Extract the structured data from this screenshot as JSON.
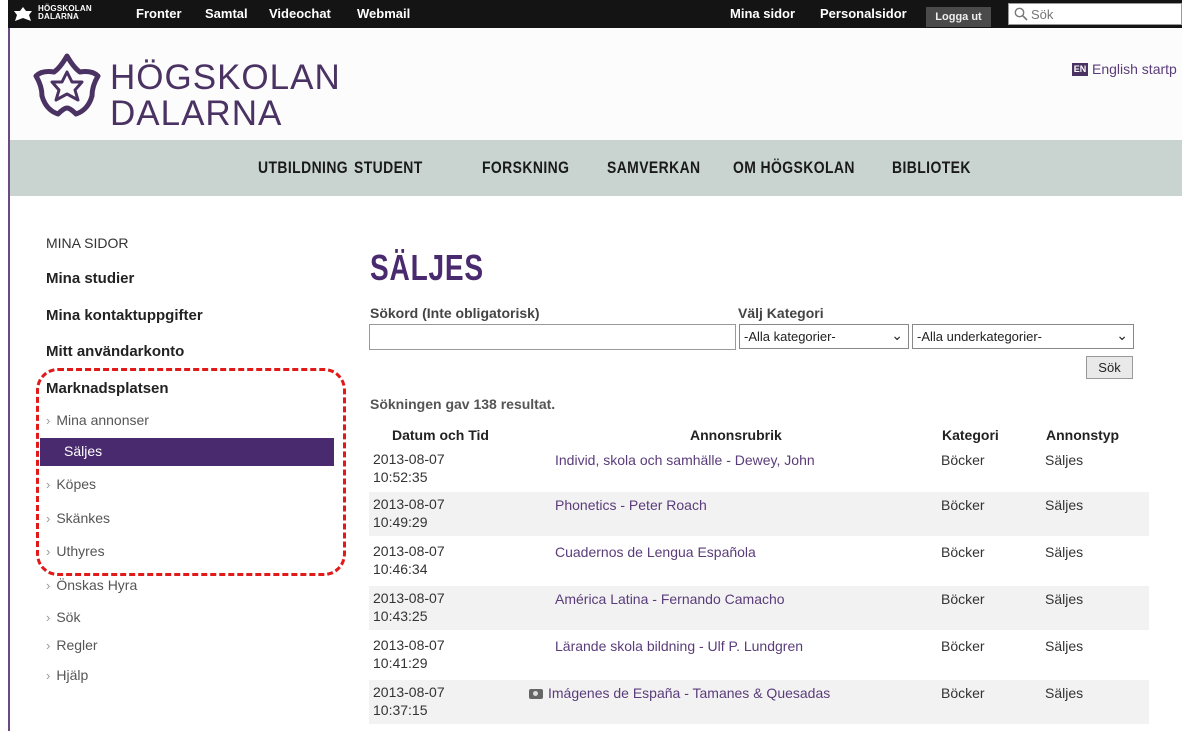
{
  "topbar": {
    "logo_line1": "HÖGSKOLAN",
    "logo_line2": "DALARNA",
    "links": [
      "Fronter",
      "Samtal",
      "Videochat",
      "Webmail"
    ],
    "right_links": [
      "Mina sidor",
      "Personalsidor"
    ],
    "logout": "Logga ut",
    "search_placeholder": "Sök"
  },
  "header": {
    "logo_line1": "HÖGSKOLAN",
    "logo_line2": "DALARNA",
    "en_badge": "EN",
    "en_link": "English startp"
  },
  "nav": [
    "UTBILDNING",
    "STUDENT",
    "FORSKNING",
    "SAMVERKAN",
    "OM HÖGSKOLAN",
    "BIBLIOTEK"
  ],
  "sidebar": {
    "heading": "MINA SIDOR",
    "items": [
      "Mina studier",
      "Mina kontaktuppgifter",
      "Mitt användarkonto",
      "Marknadsplatsen"
    ],
    "subitems": [
      "Mina annonser",
      "Säljes",
      "Köpes",
      "Skänkes",
      "Uthyres",
      "Önskas Hyra",
      "Sök",
      "Regler",
      "Hjälp"
    ],
    "active": "Säljes"
  },
  "main": {
    "title": "SÄLJES",
    "search_label": "Sökord (Inte obligatorisk)",
    "category_label": "Välj Kategori",
    "category_select": "-Alla kategorier-",
    "subcategory_select": "-Alla underkategorier-",
    "search_button": "Sök",
    "result_count": "Sökningen gav 138 resultat."
  },
  "table": {
    "headers": [
      "Datum och Tid",
      "Annonsrubrik",
      "Kategori",
      "Annonstyp"
    ],
    "rows": [
      {
        "date": "2013-08-07",
        "time": "10:52:35",
        "title": "Individ, skola och samhälle - Dewey, John",
        "category": "Böcker",
        "type": "Säljes"
      },
      {
        "date": "2013-08-07",
        "time": "10:49:29",
        "title": "Phonetics - Peter Roach",
        "category": "Böcker",
        "type": "Säljes"
      },
      {
        "date": "2013-08-07",
        "time": "10:46:34",
        "title": "Cuadernos de Lengua Española",
        "category": "Böcker",
        "type": "Säljes"
      },
      {
        "date": "2013-08-07",
        "time": "10:43:25",
        "title": "América Latina - Fernando Camacho",
        "category": "Böcker",
        "type": "Säljes"
      },
      {
        "date": "2013-08-07",
        "time": "10:41:29",
        "title": "Lärande skola bildning - Ulf P. Lundgren",
        "category": "Böcker",
        "type": "Säljes"
      },
      {
        "date": "2013-08-07",
        "time": "10:37:15",
        "title": "Imágenes de España - Tamanes & Quesadas",
        "category": "Böcker",
        "type": "Säljes"
      }
    ]
  },
  "colors": {
    "brand_purple": "#4a2a6e",
    "nav_band": "#c9d4d0",
    "annotation_red": "#e11919"
  }
}
